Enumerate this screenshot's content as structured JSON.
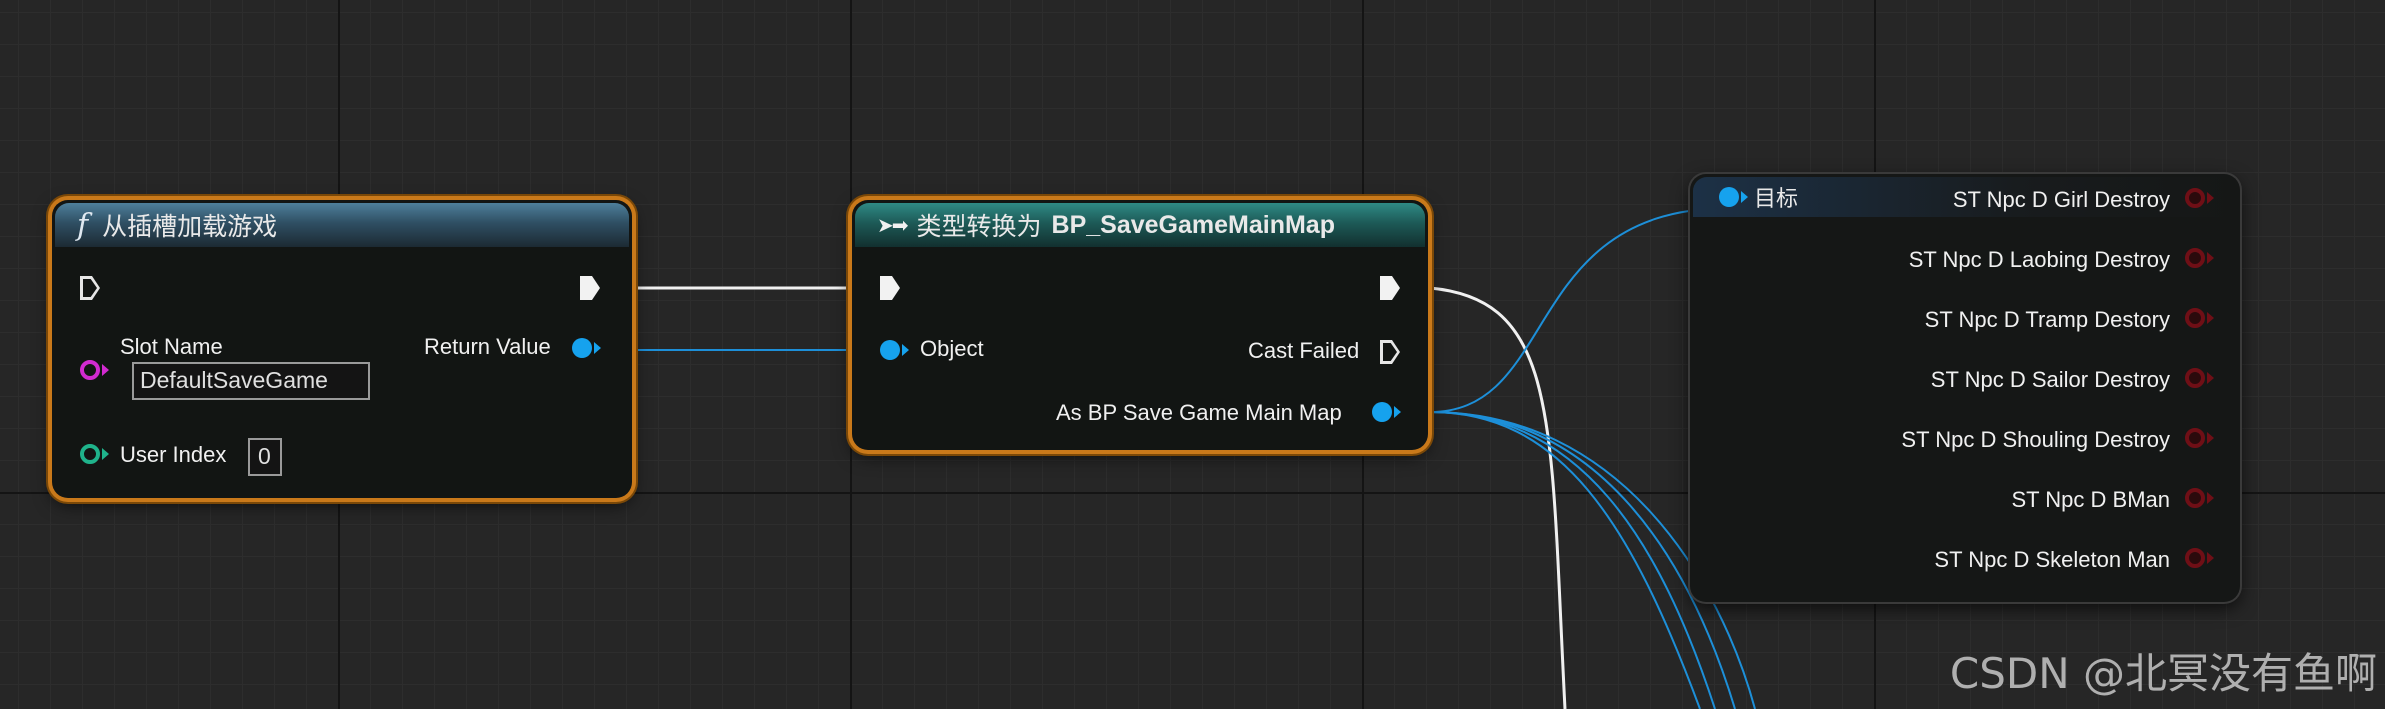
{
  "load_node": {
    "title": "从插槽加载游戏",
    "slot_name_label": "Slot Name",
    "slot_name_value": "DefaultSaveGame",
    "user_index_label": "User Index",
    "user_index_value": "0",
    "return_value_label": "Return Value"
  },
  "cast_node": {
    "title_prefix": "类型转换为",
    "title_target": "BP_SaveGameMainMap",
    "object_label": "Object",
    "cast_failed_label": "Cast Failed",
    "as_label": "As BP Save Game Main Map"
  },
  "target_node": {
    "target_label": "目标",
    "outputs": [
      "ST Npc D Girl Destroy",
      "ST Npc D Laobing Destroy",
      "ST Npc D Tramp Destory",
      "ST Npc D Sailor Destroy",
      "ST Npc D Shouling Destroy",
      "ST Npc D BMan",
      "ST Npc D Skeleton Man"
    ]
  },
  "watermark": "CSDN @北冥没有鱼啊",
  "colors": {
    "selection_border": "#c9791a",
    "object_pin": "#16a2ee",
    "string_pin": "#d22ad0",
    "int_pin": "#1fb38b",
    "bool_pin": "#6f0f16"
  }
}
